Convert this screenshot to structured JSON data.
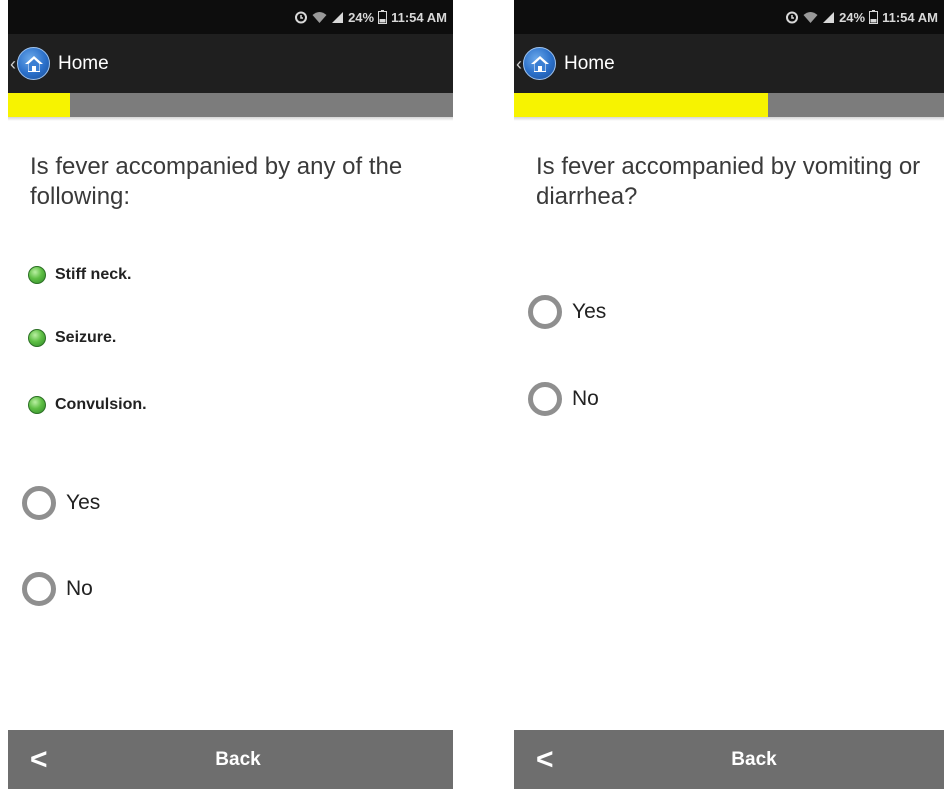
{
  "status_bar": {
    "battery": "24%",
    "time": "11:54 AM"
  },
  "app_bar": {
    "home_label": "Home"
  },
  "footer": {
    "back_chevron": "<",
    "back_label": "Back"
  },
  "colors": {
    "progress_fill": "#f7f300",
    "progress_track": "#7c7c7c",
    "symptom_dot": "#5fbf45"
  },
  "screens": [
    {
      "progress": 0.14,
      "question": "Is fever accompanied by any of the following:",
      "symptoms": [
        "Stiff neck.",
        "Seizure.",
        "Convulsion."
      ],
      "options": [
        "Yes",
        "No"
      ]
    },
    {
      "progress": 0.59,
      "question": "Is fever accompanied by vomiting or diarrhea?",
      "options": [
        "Yes",
        "No"
      ]
    }
  ]
}
